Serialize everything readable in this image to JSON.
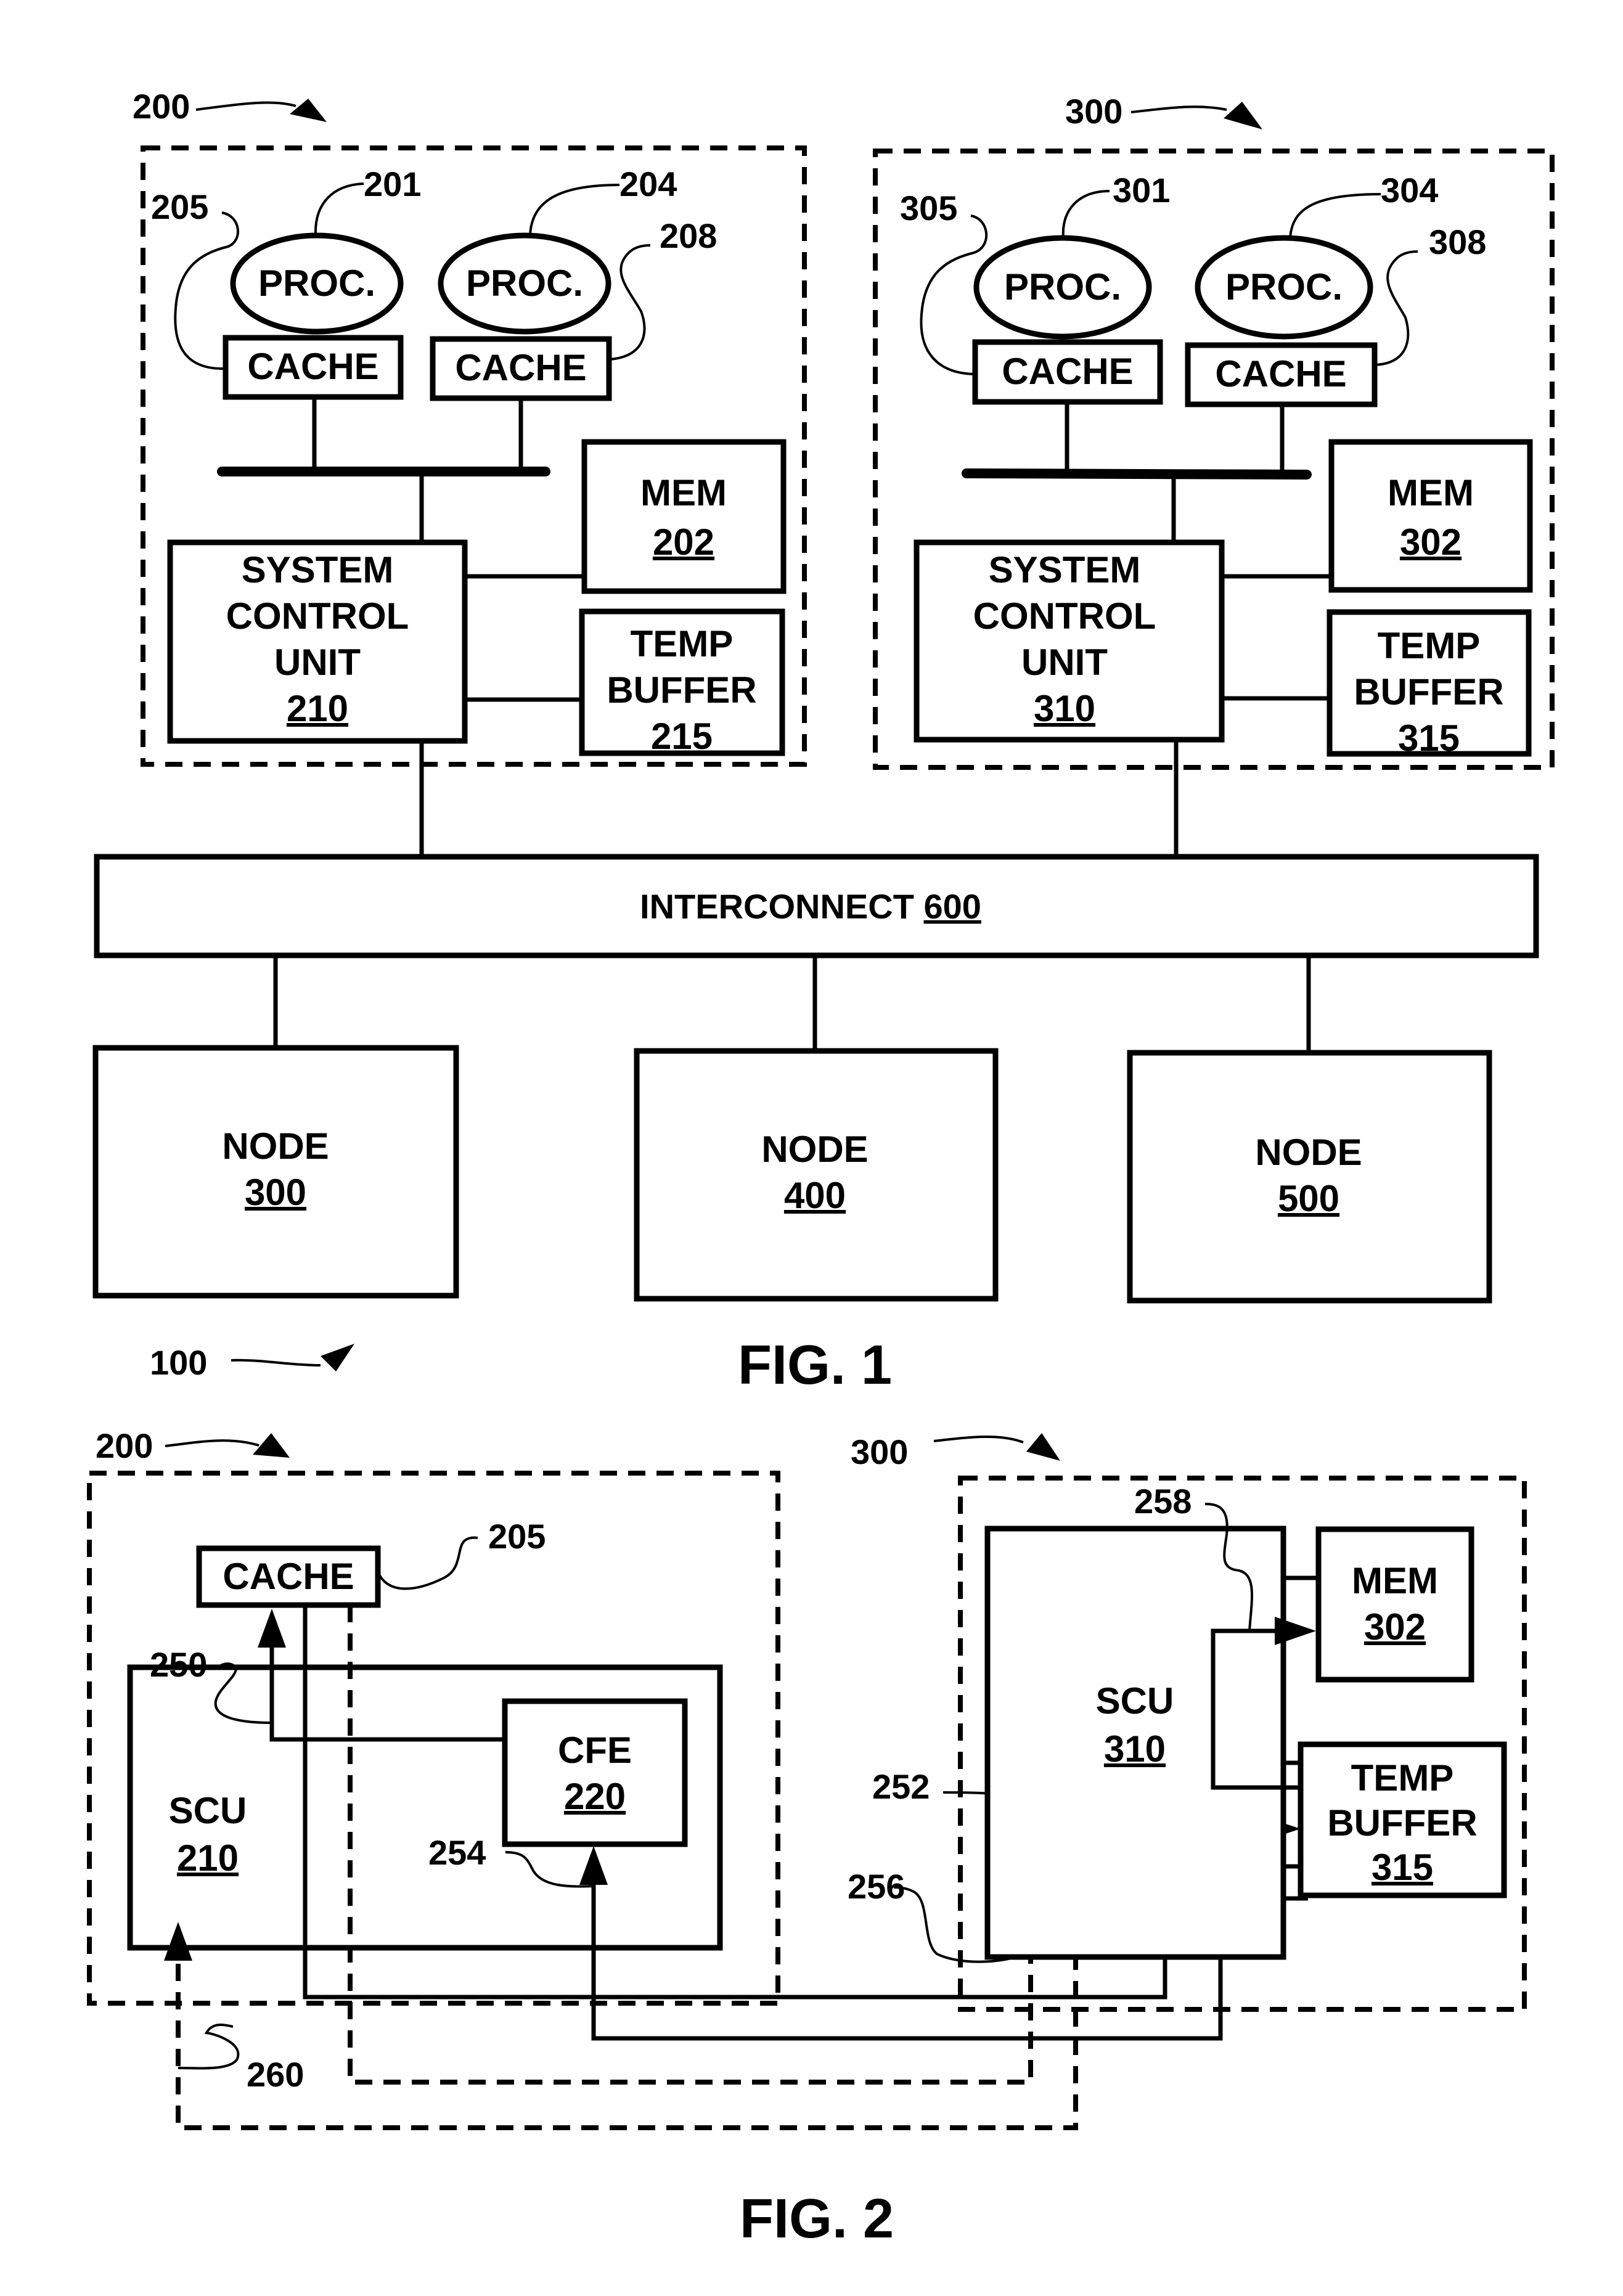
{
  "document": {
    "type": "patent drawing sheet",
    "figures": [
      "FIG. 1",
      "FIG. 2"
    ]
  },
  "fig1": {
    "caption": "FIG. 1",
    "system_ref": "100",
    "node_left": {
      "ref": "200",
      "proc1": {
        "label": "PROC.",
        "ref": "201"
      },
      "proc2": {
        "label": "PROC.",
        "ref": "204"
      },
      "cache1": {
        "label": "CACHE",
        "ref": "205"
      },
      "cache2": {
        "label": "CACHE",
        "ref": "208"
      },
      "mem": {
        "label": "MEM",
        "ref": "202"
      },
      "scu": {
        "line1": "SYSTEM",
        "line2": "CONTROL",
        "line3": "UNIT",
        "ref": "210"
      },
      "temp_buffer": {
        "line1": "TEMP",
        "line2": "BUFFER",
        "ref": "215"
      }
    },
    "node_right": {
      "ref": "300",
      "proc1": {
        "label": "PROC.",
        "ref": "301"
      },
      "proc2": {
        "label": "PROC.",
        "ref": "304"
      },
      "cache1": {
        "label": "CACHE",
        "ref": "305"
      },
      "cache2": {
        "label": "CACHE",
        "ref": "308"
      },
      "mem": {
        "label": "MEM",
        "ref": "302"
      },
      "scu": {
        "line1": "SYSTEM",
        "line2": "CONTROL",
        "line3": "UNIT",
        "ref": "310"
      },
      "temp_buffer": {
        "line1": "TEMP",
        "line2": "BUFFER",
        "ref": "315"
      }
    },
    "interconnect": {
      "label": "INTERCONNECT",
      "ref": "600"
    },
    "nodes": [
      {
        "label": "NODE",
        "ref": "300"
      },
      {
        "label": "NODE",
        "ref": "400"
      },
      {
        "label": "NODE",
        "ref": "500"
      }
    ]
  },
  "fig2": {
    "caption": "FIG. 2",
    "node_left": {
      "ref": "200",
      "cache": {
        "label": "CACHE",
        "ref": "205"
      },
      "scu": {
        "label": "SCU",
        "ref": "210"
      },
      "cfe": {
        "label": "CFE",
        "ref": "220"
      }
    },
    "node_right": {
      "ref": "300",
      "scu": {
        "label": "SCU",
        "ref": "310"
      },
      "mem": {
        "label": "MEM",
        "ref": "302"
      },
      "temp_buffer": {
        "line1": "TEMP",
        "line2": "BUFFER",
        "ref": "315"
      }
    },
    "paths": {
      "p250": "250",
      "p252": "252",
      "p254": "254",
      "p256": "256",
      "p258": "258",
      "p260": "260"
    }
  }
}
